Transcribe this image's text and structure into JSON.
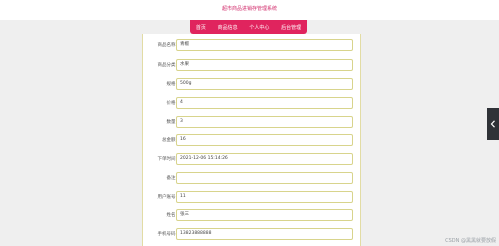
{
  "header": {
    "site_title": "超市商品进销存管理系统"
  },
  "nav": {
    "items": [
      {
        "label": "首页"
      },
      {
        "label": "商品信息"
      },
      {
        "label": "个人中心"
      },
      {
        "label": "后台管理"
      }
    ]
  },
  "form": {
    "fields": [
      {
        "label": "商品名称:",
        "value": "青椒"
      },
      {
        "label": "商品分类:",
        "value": "水果"
      },
      {
        "label": "规格:",
        "value": "500g"
      },
      {
        "label": "价格:",
        "value": "4"
      },
      {
        "label": "数量:",
        "value": "3"
      },
      {
        "label": "总金额:",
        "value": "16"
      },
      {
        "label": "下单时间:",
        "value": "2021-12-06 15:14:26"
      },
      {
        "label": "备注:",
        "value": ""
      },
      {
        "label": "用户账号:",
        "value": "11"
      },
      {
        "label": "姓名:",
        "value": "张三"
      },
      {
        "label": "手机号码:",
        "value": "13823888888"
      }
    ]
  },
  "side_tab": {
    "icon": "chevron-left-icon"
  },
  "watermark": {
    "text": "CSDN @黑黑就要放假"
  }
}
